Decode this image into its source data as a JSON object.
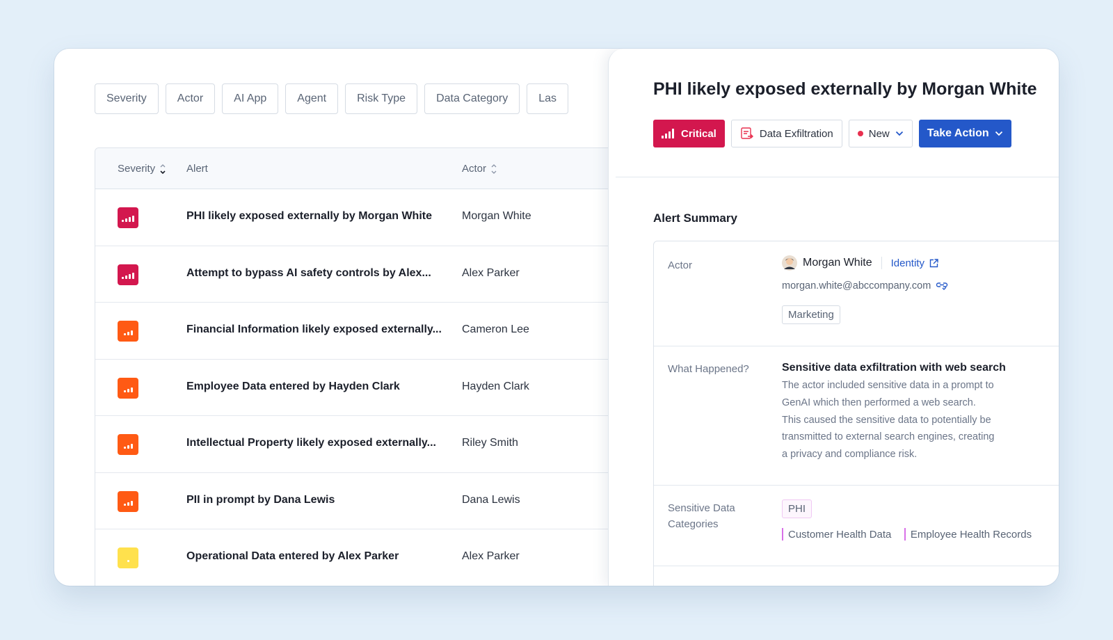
{
  "filters": [
    "Severity",
    "Actor",
    "AI App",
    "Agent",
    "Risk Type",
    "Data Category",
    "Las"
  ],
  "table": {
    "headers": {
      "severity": "Severity",
      "alert": "Alert",
      "actor": "Actor"
    },
    "rows": [
      {
        "severity": "critical",
        "color": "#d3174e",
        "bars": 4,
        "alert": "PHI likely exposed externally by Morgan White",
        "actor": "Morgan White"
      },
      {
        "severity": "critical",
        "color": "#d3174e",
        "bars": 4,
        "alert": "Attempt to bypass AI safety controls by Alex...",
        "actor": "Alex Parker"
      },
      {
        "severity": "high",
        "color": "#ff5a14",
        "bars": 3,
        "alert": "Financial Information likely exposed externally...",
        "actor": "Cameron Lee"
      },
      {
        "severity": "high",
        "color": "#ff5a14",
        "bars": 3,
        "alert": "Employee Data entered by Hayden Clark",
        "actor": "Hayden Clark"
      },
      {
        "severity": "high",
        "color": "#ff5a14",
        "bars": 3,
        "alert": "Intellectual Property likely exposed externally...",
        "actor": "Riley Smith"
      },
      {
        "severity": "high",
        "color": "#ff5a14",
        "bars": 3,
        "alert": "PII in prompt by Dana Lewis",
        "actor": "Dana Lewis"
      },
      {
        "severity": "medium",
        "color": "#ffe14d",
        "bars": 1,
        "alert": "Operational Data entered by Alex Parker",
        "actor": "Alex Parker"
      }
    ]
  },
  "panel": {
    "title": "PHI likely exposed externally by Morgan White",
    "severity_label": "Critical",
    "risk_type": "Data Exfiltration",
    "status": "New",
    "action_label": "Take Action",
    "summary_title": "Alert Summary",
    "actor": {
      "label": "Actor",
      "name": "Morgan White",
      "identity_link": "Identity",
      "email": "morgan.white@abccompany.com",
      "department": "Marketing"
    },
    "what_happened": {
      "label": "What Happened?",
      "heading": "Sensitive data exfiltration with web search",
      "lines": [
        "The actor included sensitive data in a prompt to",
        "GenAI which then performed a web search.",
        "This caused the sensitive data to potentially be",
        "transmitted to external search engines, creating",
        "a privacy and compliance risk."
      ]
    },
    "categories": {
      "label_line1": "Sensitive Data",
      "label_line2": "Categories",
      "primary": "PHI",
      "items": [
        "Customer Health Data",
        "Employee Health Records"
      ]
    }
  },
  "colors": {
    "critical": "#d3174e",
    "high": "#ff5a14",
    "medium": "#ffe14d",
    "primary": "#2458c9",
    "status_dot": "#e8304f"
  }
}
